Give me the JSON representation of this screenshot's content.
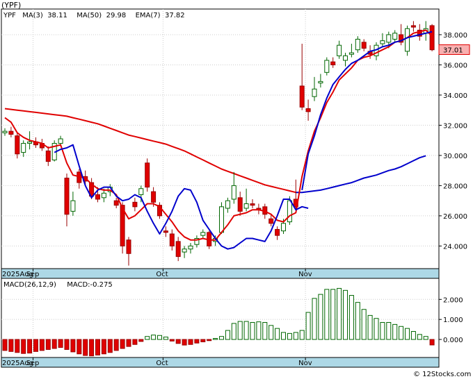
{
  "chart_data": [
    {
      "type": "candlestick",
      "title": "(YPF)",
      "ticker": "YPF",
      "ylim": [
        22.5,
        39.7
      ],
      "yticks": [
        24.0,
        26.0,
        28.0,
        30.0,
        32.0,
        34.0,
        36.0,
        38.0
      ],
      "ytick_labels": [
        "24.000",
        "26.000",
        "28.000",
        "30.000",
        "32.000",
        "34.000",
        "36.000",
        "38.000"
      ],
      "last_price": 37.01,
      "last_price_label": "37.01",
      "x_labels": [
        {
          "index": 0,
          "text": "2025Aug"
        },
        {
          "index": 5,
          "text": "Sep"
        },
        {
          "index": 26,
          "text": "Oct"
        },
        {
          "index": 49,
          "text": "Nov"
        }
      ],
      "legend": [
        {
          "label": "YPF",
          "color": "#006600"
        },
        {
          "label": "MA(3)",
          "value": "38.11",
          "color": "#0000cc"
        },
        {
          "label": "MA(50)",
          "value": "29.98",
          "color": "#cc0000"
        },
        {
          "label": "EMA(7)",
          "value": "37.82",
          "color": "#0000cc"
        }
      ],
      "colors": {
        "up": "#ffffff",
        "up_border": "#006600",
        "down": "#e00000",
        "down_border": "#990000",
        "ma50": "#e00000",
        "ema_red": "#e00000",
        "ma_blue": "#0000cc",
        "axis_bar": "#add8e6"
      },
      "candles": [
        [
          31.5,
          31.8,
          31.3,
          31.6
        ],
        [
          31.6,
          31.9,
          31.2,
          31.4
        ],
        [
          31.3,
          31.5,
          29.8,
          30.1
        ],
        [
          30.2,
          31.0,
          29.9,
          30.8
        ],
        [
          30.8,
          31.6,
          30.4,
          30.9
        ],
        [
          30.9,
          31.2,
          30.5,
          30.7
        ],
        [
          30.8,
          31.1,
          30.3,
          30.5
        ],
        [
          30.3,
          30.6,
          29.3,
          29.6
        ],
        [
          29.7,
          31.0,
          29.6,
          30.8
        ],
        [
          30.8,
          31.3,
          30.6,
          31.1
        ],
        [
          28.5,
          28.8,
          25.3,
          26.1
        ],
        [
          26.3,
          27.6,
          26.0,
          27.0
        ],
        [
          28.9,
          29.1,
          27.8,
          28.2
        ],
        [
          28.6,
          29.0,
          28.0,
          28.3
        ],
        [
          28.2,
          28.5,
          27.1,
          27.3
        ],
        [
          27.4,
          27.9,
          26.9,
          27.1
        ],
        [
          27.2,
          27.8,
          26.9,
          27.5
        ],
        [
          27.6,
          28.1,
          27.3,
          27.9
        ],
        [
          27.0,
          27.2,
          26.5,
          26.7
        ],
        [
          26.7,
          26.9,
          23.5,
          24.0
        ],
        [
          24.4,
          24.6,
          22.7,
          23.5
        ],
        [
          26.9,
          27.2,
          26.3,
          26.6
        ],
        [
          27.4,
          28.0,
          26.9,
          27.8
        ],
        [
          29.5,
          29.8,
          27.6,
          27.9
        ],
        [
          27.6,
          27.9,
          26.6,
          26.9
        ],
        [
          26.7,
          26.9,
          25.8,
          26.0
        ],
        [
          25.0,
          25.3,
          24.6,
          24.9
        ],
        [
          24.8,
          25.1,
          23.7,
          24.0
        ],
        [
          24.3,
          24.6,
          23.0,
          23.3
        ],
        [
          23.6,
          24.0,
          23.2,
          23.8
        ],
        [
          23.8,
          24.2,
          23.5,
          24.0
        ],
        [
          24.1,
          24.7,
          23.9,
          24.5
        ],
        [
          24.7,
          25.1,
          24.5,
          24.9
        ],
        [
          24.9,
          25.0,
          23.8,
          24.0
        ],
        [
          24.3,
          24.7,
          24.0,
          24.5
        ],
        [
          24.9,
          26.9,
          24.8,
          26.6
        ],
        [
          26.5,
          27.2,
          26.2,
          27.0
        ],
        [
          27.1,
          28.9,
          26.8,
          28.0
        ],
        [
          27.2,
          27.6,
          26.0,
          26.3
        ],
        [
          26.5,
          27.8,
          26.3,
          26.8
        ],
        [
          26.8,
          27.1,
          26.5,
          26.7
        ],
        [
          26.5,
          26.8,
          26.1,
          26.4
        ],
        [
          26.6,
          26.8,
          25.8,
          26.1
        ],
        [
          25.8,
          26.1,
          25.3,
          25.5
        ],
        [
          25.1,
          25.3,
          24.4,
          24.7
        ],
        [
          25.0,
          25.8,
          24.8,
          25.5
        ],
        [
          25.6,
          27.3,
          25.4,
          27.0
        ],
        [
          27.1,
          28.4,
          26.4,
          26.6
        ],
        [
          34.6,
          37.4,
          33.0,
          33.2
        ],
        [
          33.1,
          33.7,
          32.3,
          32.9
        ],
        [
          33.9,
          35.2,
          33.6,
          34.4
        ],
        [
          34.8,
          35.4,
          34.5,
          34.9
        ],
        [
          35.5,
          36.5,
          35.3,
          36.3
        ],
        [
          36.2,
          36.5,
          35.8,
          36.0
        ],
        [
          36.6,
          37.6,
          36.4,
          37.3
        ],
        [
          36.3,
          36.8,
          35.9,
          36.6
        ],
        [
          36.7,
          37.4,
          36.5,
          36.8
        ],
        [
          37.0,
          37.9,
          36.8,
          37.7
        ],
        [
          37.5,
          37.7,
          36.9,
          37.1
        ],
        [
          36.9,
          37.3,
          36.4,
          36.7
        ],
        [
          36.6,
          37.5,
          36.3,
          37.3
        ],
        [
          37.4,
          38.1,
          37.2,
          37.6
        ],
        [
          37.5,
          38.2,
          37.1,
          38.0
        ],
        [
          37.7,
          38.3,
          37.5,
          38.1
        ],
        [
          38.0,
          38.7,
          37.3,
          37.5
        ],
        [
          36.9,
          38.6,
          36.6,
          38.4
        ],
        [
          38.6,
          38.9,
          38.2,
          38.5
        ],
        [
          38.3,
          38.7,
          37.6,
          37.9
        ],
        [
          38.1,
          38.9,
          37.6,
          38.4
        ],
        [
          38.6,
          38.7,
          36.9,
          37.0
        ]
      ],
      "ma50": [
        33.1,
        33.05,
        33.0,
        32.95,
        32.9,
        32.85,
        32.8,
        32.75,
        32.7,
        32.65,
        32.6,
        32.5,
        32.4,
        32.3,
        32.2,
        32.1,
        31.95,
        31.8,
        31.65,
        31.5,
        31.35,
        31.25,
        31.15,
        31.05,
        30.95,
        30.85,
        30.75,
        30.6,
        30.45,
        30.3,
        30.1,
        29.9,
        29.7,
        29.5,
        29.3,
        29.1,
        28.95,
        28.8,
        28.65,
        28.5,
        28.35,
        28.2,
        28.05,
        27.95,
        27.85,
        27.75,
        27.65,
        27.55
      ],
      "ema7": [
        32.5,
        32.2,
        31.5,
        31.2,
        31.0,
        30.9,
        30.8,
        30.5,
        30.6,
        30.7,
        29.5,
        28.7,
        28.6,
        28.5,
        28.1,
        27.8,
        27.7,
        27.7,
        27.4,
        26.5,
        25.8,
        26.0,
        26.4,
        26.8,
        26.8,
        26.6,
        26.1,
        25.6,
        25.0,
        24.6,
        24.4,
        24.4,
        24.5,
        24.4,
        24.4,
        24.9,
        25.4,
        26.0,
        26.1,
        26.2,
        26.4,
        26.4,
        26.3,
        26.1,
        25.7,
        25.6,
        26.0,
        26.2,
        28.6,
        30.3,
        31.6,
        32.5,
        33.5,
        34.2,
        35.0,
        35.4,
        35.8,
        36.3,
        36.5,
        36.6,
        36.8,
        37.0,
        37.2,
        37.5,
        37.6,
        37.8,
        38.1,
        38.2,
        38.3,
        37.9
      ],
      "ma3_blue_start": 8,
      "ma3_blue_end": 48,
      "ma3_blue": [
        30.2,
        30.4,
        30.5,
        30.7,
        29.3,
        28.0,
        27.2,
        27.7,
        27.9,
        27.9,
        27.3,
        27.0,
        27.1,
        27.4,
        27.2,
        26.3,
        25.5,
        24.8,
        25.5,
        26.3,
        27.3,
        27.8,
        27.7,
        26.9,
        25.7,
        25.1,
        24.5,
        24.0,
        23.8,
        23.9,
        24.2,
        24.5,
        24.5,
        24.4,
        24.3,
        25.0,
        26.0,
        27.1,
        27.1,
        26.4,
        26.6,
        26.5
      ],
      "ema7_blue_start": 48,
      "ema7_blue": [
        27.7,
        30.1,
        31.3,
        32.7,
        33.8,
        34.7,
        35.2,
        35.7,
        36.1,
        36.3,
        36.6,
        36.9,
        37.0,
        37.2,
        37.3,
        37.5,
        37.6,
        37.8,
        37.9,
        38.0,
        38.1,
        38.2
      ],
      "ma50_line2_start": 47,
      "ma50_line2": [
        27.55,
        27.55,
        27.6,
        27.65,
        27.7,
        27.8,
        27.9,
        28.0,
        28.1,
        28.2,
        28.35,
        28.5,
        28.6,
        28.7,
        28.85,
        29.0,
        29.1,
        29.25,
        29.45,
        29.65,
        29.85,
        29.98
      ]
    },
    {
      "type": "bar",
      "title": "MACD(26,12,9)",
      "legend": [
        {
          "label": "MACD(26,12,9)",
          "color": "#000000"
        },
        {
          "label": "MACD:-0.275",
          "color": "#0000cc"
        }
      ],
      "ylim": [
        -0.9,
        3.05
      ],
      "yticks": [
        0.0,
        1.0,
        2.0
      ],
      "ytick_labels": [
        "0.000",
        "1.000",
        "2.000"
      ],
      "x_labels": [
        {
          "index": 0,
          "text": "2025Aug"
        },
        {
          "index": 5,
          "text": "Sep"
        },
        {
          "index": 26,
          "text": "Oct"
        },
        {
          "index": 49,
          "text": "Nov"
        }
      ],
      "values": [
        -0.55,
        -0.6,
        -0.65,
        -0.7,
        -0.68,
        -0.6,
        -0.55,
        -0.5,
        -0.45,
        -0.4,
        -0.5,
        -0.62,
        -0.72,
        -0.8,
        -0.82,
        -0.78,
        -0.72,
        -0.65,
        -0.55,
        -0.45,
        -0.35,
        -0.25,
        -0.1,
        0.15,
        0.22,
        0.2,
        0.12,
        -0.08,
        -0.2,
        -0.28,
        -0.25,
        -0.18,
        -0.12,
        -0.06,
        0.05,
        0.15,
        0.45,
        0.8,
        0.9,
        0.9,
        0.85,
        0.88,
        0.85,
        0.7,
        0.55,
        0.35,
        0.3,
        0.35,
        0.45,
        1.35,
        2.05,
        2.25,
        2.5,
        2.5,
        2.55,
        2.45,
        2.2,
        1.85,
        1.5,
        1.2,
        1.05,
        0.85,
        0.85,
        0.75,
        0.65,
        0.55,
        0.4,
        0.25,
        0.15,
        -0.275
      ]
    }
  ],
  "watermark": "© 12Stocks.com"
}
